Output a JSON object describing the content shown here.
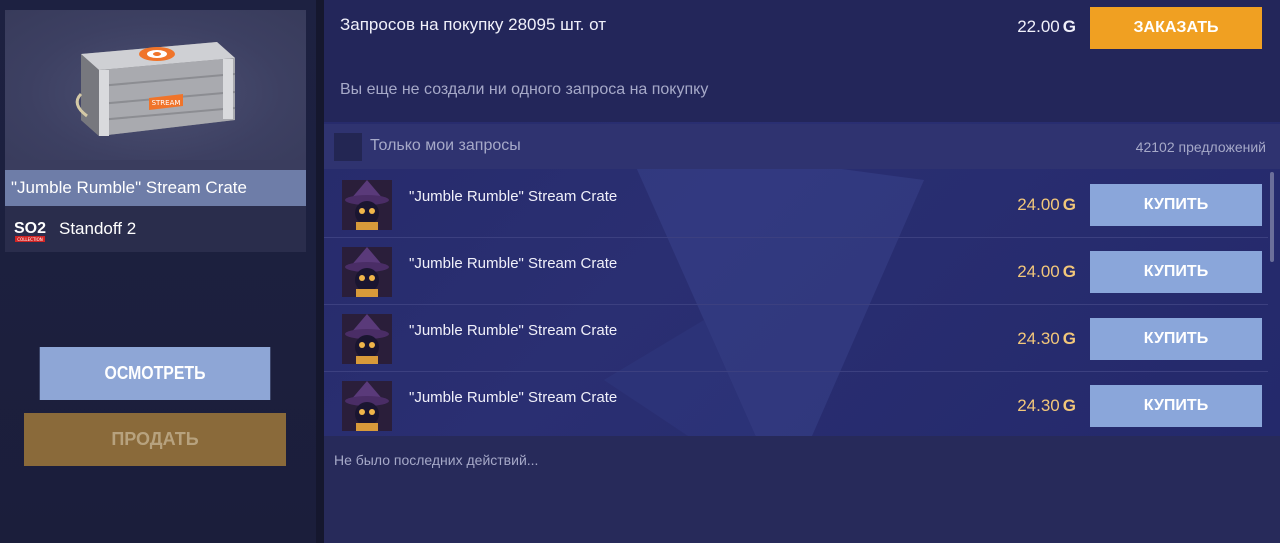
{
  "item": {
    "name": "\"Jumble Rumble\" Stream Crate",
    "crate_label": "STREAM",
    "game": "Standoff 2",
    "game_logo_text": "SO2",
    "game_logo_subtext": "COLLECTION"
  },
  "actions": {
    "inspect_label": "ОСМОТРЕТЬ",
    "sell_label": "ПРОДАТЬ"
  },
  "orders": {
    "title": "Запросов на покупку 28095 шт. от",
    "price": "22.00",
    "currency_symbol": "G",
    "order_button": "ЗАКАЗАТЬ",
    "empty_message": "Вы еще не создали ни одного запроса на покупку"
  },
  "filter": {
    "only_mine_label": "Только мои запросы",
    "offers_count": "42102 предложений"
  },
  "listings": [
    {
      "name": "\"Jumble Rumble\" Stream Crate",
      "price": "24.00",
      "buy_label": "КУПИТЬ"
    },
    {
      "name": "\"Jumble Rumble\" Stream Crate",
      "price": "24.00",
      "buy_label": "КУПИТЬ"
    },
    {
      "name": "\"Jumble Rumble\" Stream Crate",
      "price": "24.30",
      "buy_label": "КУПИТЬ"
    },
    {
      "name": "\"Jumble Rumble\" Stream Crate",
      "price": "24.30",
      "buy_label": "КУПИТЬ"
    }
  ],
  "activity": {
    "empty_message": "Не было последних действий..."
  },
  "colors": {
    "order_button": "#f0a022",
    "buy_button": "#8aa6da",
    "price_text": "#f2c77a",
    "sell_button": "#8a6a3a"
  },
  "icons": {
    "avatar": "witch-avatar-icon",
    "checkbox": "checkbox-icon"
  }
}
